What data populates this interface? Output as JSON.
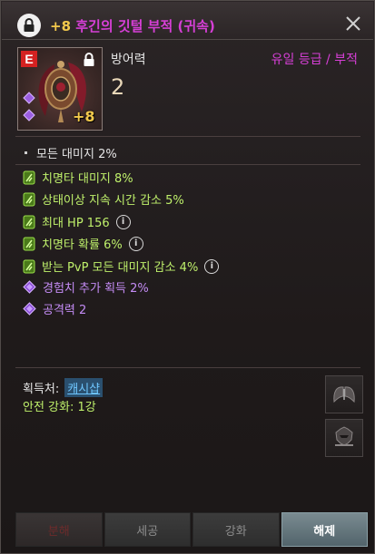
{
  "header": {
    "enhance_level": "+8",
    "item_name": "후긴의 깃털 부적 (귀속)",
    "close_icon": "close-icon"
  },
  "item": {
    "grade_letter": "E",
    "plus_label": "+8",
    "icon": "feather-talisman-icon"
  },
  "stat": {
    "label": "방어력",
    "value": "2",
    "grade_type": "유일 등급 / 부적"
  },
  "base_option": "모든 대미지 2%",
  "options": [
    {
      "text": "치명타 대미지 8%",
      "color": "green",
      "info": false
    },
    {
      "text": "상태이상 지속 시간 감소 5%",
      "color": "green",
      "info": false
    },
    {
      "text": "최대 HP 156",
      "color": "green",
      "info": true
    },
    {
      "text": "치명타 확률 6%",
      "color": "green",
      "info": true
    },
    {
      "text": "받는 PvP 모든 대미지 감소 4%",
      "color": "green",
      "info": true
    },
    {
      "text": "경험치 추가 획득 2%",
      "color": "purple",
      "info": false
    },
    {
      "text": "공격력 2",
      "color": "purple",
      "info": false
    }
  ],
  "acquisition": {
    "label": "획득처:",
    "link": "캐시샵"
  },
  "safe_enhance": "안전 강화: 1강",
  "buttons": {
    "dismantle": "분해",
    "craft": "세공",
    "enhance": "강화",
    "unlock": "해제"
  },
  "colors": {
    "title_purple": "#d63fd6",
    "option_green": "#bff06b",
    "option_purple": "#c48cf5",
    "gold": "#f2c94c"
  }
}
